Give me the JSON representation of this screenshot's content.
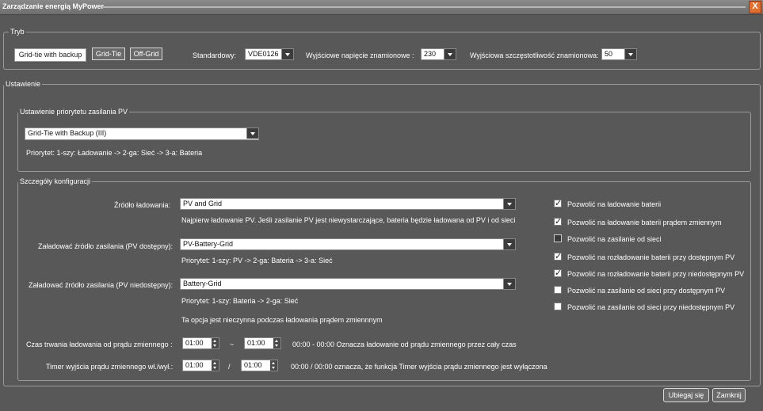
{
  "window": {
    "title": "Zarządzanie energią MyPower",
    "close_symbol": "X"
  },
  "tryb": {
    "legend": "Tryb",
    "mode_buttons": [
      "Grid-tie with backup",
      "Grid-Tie",
      "Off-Grid"
    ],
    "standard_label": "Standardowy:",
    "standard_value": "VDE0126",
    "voltage_label": "Wyjściowe napięcie znamionowe :",
    "voltage_value": "230",
    "frequency_label": "Wyjściowa szczęstotliwość znamionowa:",
    "frequency_value": "50"
  },
  "ustawienie": {
    "legend": "Ustawienie",
    "priority": {
      "legend": "Ustawienie priorytetu zasilania PV",
      "select_value": "Grid-Tie with Backup (III)",
      "note": "Priorytet: 1-szy: Ładowanie -> 2-ga: Sieć -> 3-a: Bateria"
    },
    "config": {
      "legend": "Szczegóły konfiguracji",
      "charge_source_label": "Źródło ładowania:",
      "charge_source_value": "PV and Grid",
      "charge_source_note": "Najpierw ładowanie PV. Jeśli zasilanie PV jest niewystarczające, bateria będzie ładowana od PV i od sieci",
      "load_pv_avail_label": "Załadować źródło zasilania (PV dostępny):",
      "load_pv_avail_value": "PV-Battery-Grid",
      "load_pv_avail_note": "Priorytet: 1-szy: PV -> 2-ga: Bateria -> 3-a: Sieć",
      "load_pv_unavail_label": "Załadować źródło zasilania (PV niedostępny):",
      "load_pv_unavail_value": "Battery-Grid",
      "load_pv_unavail_note": "Priorytet: 1-szy: Bateria -> 2-ga: Sieć",
      "load_pv_unavail_note2": "Ta opcja jest nieczynna podczas ładowania prądem zmiennnym",
      "ac_duration_label": "Czas trwania ładowania od prądu zmiennego :",
      "ac_duration_from": "01:00",
      "ac_duration_sep": "~",
      "ac_duration_to": "01:00",
      "ac_duration_note": "00:00 - 00:00 Oznacza ładowanie od prądu zmiennego przez cały czas",
      "ac_timer_label": "Timer wyjścia prądu zmiennego wł./wył.:",
      "ac_timer_from": "01:00",
      "ac_timer_sep": "/",
      "ac_timer_to": "01:00",
      "ac_timer_note": "00:00 / 00:00 oznacza, że funkcja Timer wyjścia prądu zmiennego jest wyłączona",
      "checkboxes": [
        {
          "label": "Pozwolić na ładowanie baterii",
          "checked": true
        },
        {
          "label": "Pozwolić na ładowanie baterii prądem zmiennym",
          "checked": true
        },
        {
          "label": "Pozwolić na zasilanie od sieci",
          "checked": false
        },
        {
          "label": "Pozwolić na rozładowanie baterii przy dostępnym PV",
          "checked": true
        },
        {
          "label": "Pozwolić na rozładowanie baterii przy niedostępnym PV",
          "checked": true
        },
        {
          "label": "Pozwolić na zasilanie od sieci przy dostępnym PV",
          "checked": false
        },
        {
          "label": "Pozwolić na zasilanie od sieci przy niedostępnym PV",
          "checked": false
        }
      ]
    }
  },
  "footer": {
    "apply_label": "Ubiegaj się",
    "close_label": "Zamknij"
  }
}
